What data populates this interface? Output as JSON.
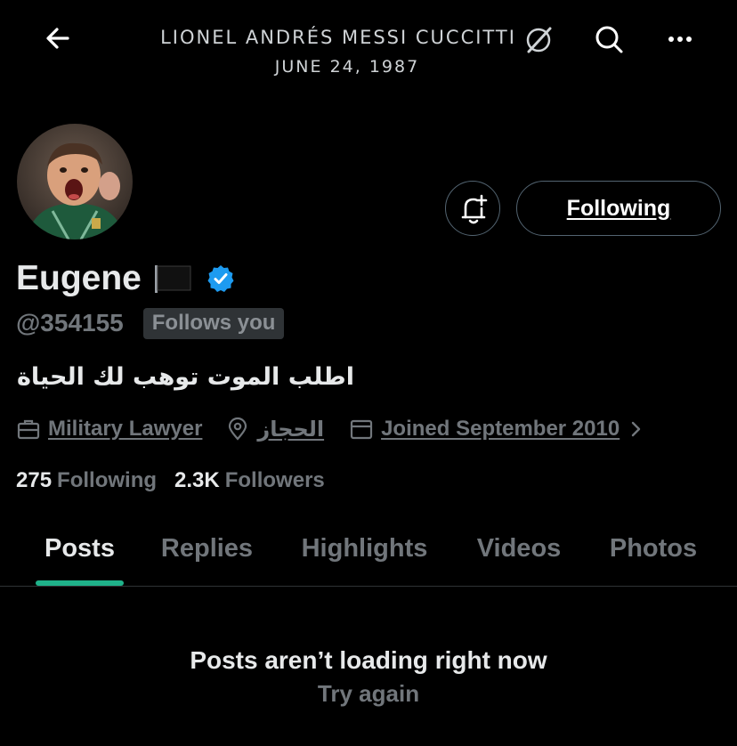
{
  "header": {
    "banner_title": "LIONEL ANDRÉS MESSI CUCCITTI",
    "banner_date": "JUNE 24, 1987",
    "back_icon": "arrow-left-icon",
    "search_icon": "search-icon",
    "more_icon": "more-horizontal-icon"
  },
  "profile": {
    "display_name": "Eugene",
    "handle": "@354155",
    "follows_you": "Follows you",
    "bio": "اطلب الموت توهب لك الحياة",
    "following_button": "Following",
    "verified_color": "#1d9bf0"
  },
  "meta": {
    "profession": "Military Lawyer",
    "location": "الحجاز",
    "joined": "Joined September 2010"
  },
  "stats": {
    "following_count": "275",
    "following_label": "Following",
    "followers_count": "2.3K",
    "followers_label": "Followers"
  },
  "tabs": [
    {
      "label": "Posts",
      "active": true
    },
    {
      "label": "Replies"
    },
    {
      "label": "Highlights"
    },
    {
      "label": "Videos"
    },
    {
      "label": "Photos"
    }
  ],
  "accent_color": "#1fb28a",
  "empty_state": {
    "title": "Posts aren’t loading right now",
    "action": "Try again"
  }
}
